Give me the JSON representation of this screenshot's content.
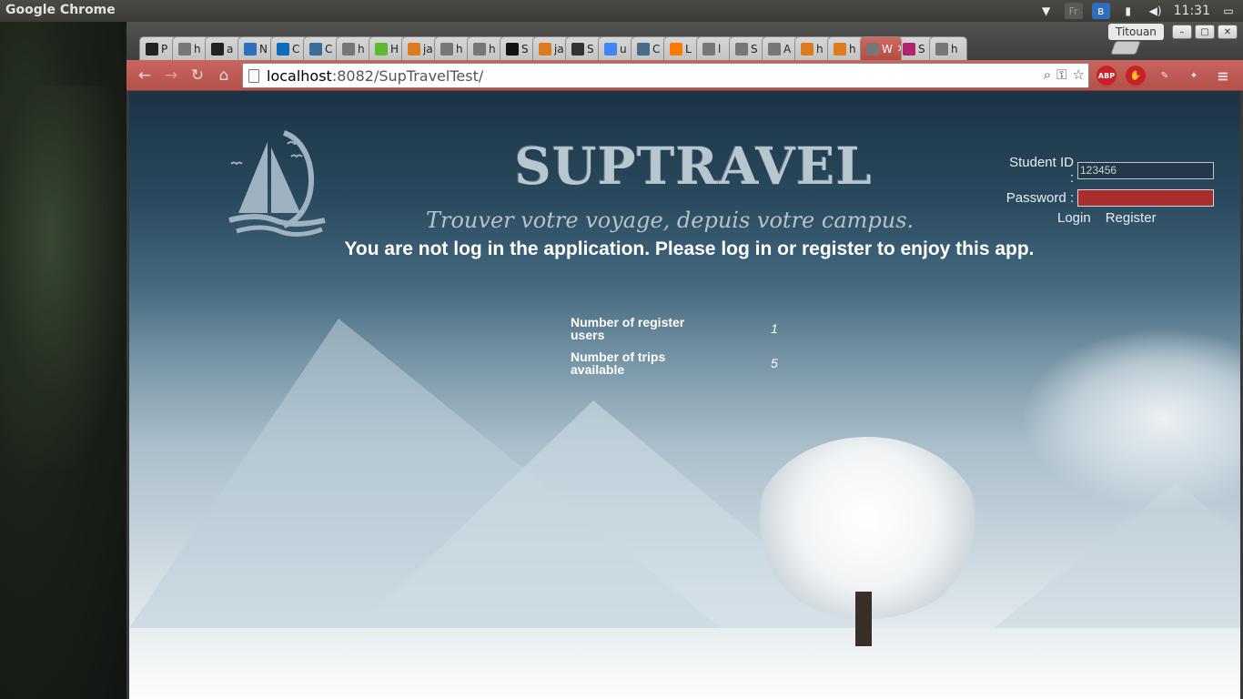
{
  "os": {
    "app_title": "Google Chrome",
    "tray": {
      "keyboard_layout": "Fr",
      "clock": "11:31"
    }
  },
  "browser": {
    "profile_name": "Titouan",
    "tabs": [
      {
        "letter": "P",
        "icon": "github-icon",
        "color": "#222222"
      },
      {
        "letter": "h",
        "icon": "page-icon",
        "color": "#777777"
      },
      {
        "letter": "a",
        "icon": "github-icon",
        "color": "#222222"
      },
      {
        "letter": "N",
        "icon": "mail-icon",
        "color": "#2f6ebd"
      },
      {
        "letter": "C",
        "icon": "outlook-icon",
        "color": "#0f6cbd"
      },
      {
        "letter": "C",
        "icon": "globe-icon",
        "color": "#3a6c9a"
      },
      {
        "letter": "h",
        "icon": "page-icon",
        "color": "#777777"
      },
      {
        "letter": "H",
        "icon": "badge-icon",
        "color": "#5fb830"
      },
      {
        "letter": "ja",
        "icon": "java-icon",
        "color": "#e07a1f"
      },
      {
        "letter": "h",
        "icon": "page-icon",
        "color": "#777777"
      },
      {
        "letter": "h",
        "icon": "page-icon",
        "color": "#777777"
      },
      {
        "letter": "S",
        "icon": "n-icon",
        "color": "#111111"
      },
      {
        "letter": "ja",
        "icon": "java-icon",
        "color": "#e07a1f"
      },
      {
        "letter": "S",
        "icon": "sql-icon",
        "color": "#333333"
      },
      {
        "letter": "u",
        "icon": "google-icon",
        "color": "#4285f4"
      },
      {
        "letter": "C",
        "icon": "globe-icon",
        "color": "#4a6a8a"
      },
      {
        "letter": "L",
        "icon": "orange-icon",
        "color": "#ff7900"
      },
      {
        "letter": "l",
        "icon": "page-icon",
        "color": "#777777"
      },
      {
        "letter": "S",
        "icon": "page-icon",
        "color": "#777777"
      },
      {
        "letter": "A",
        "icon": "page-icon",
        "color": "#777777"
      },
      {
        "letter": "h",
        "icon": "java-icon",
        "color": "#e07a1f"
      },
      {
        "letter": "h",
        "icon": "java-icon",
        "color": "#e07a1f"
      },
      {
        "letter": "W",
        "icon": "page-icon",
        "color": "#777777",
        "active": true
      },
      {
        "letter": "S",
        "icon": "sncf-icon",
        "color": "#b3226c"
      },
      {
        "letter": "h",
        "icon": "page-icon",
        "color": "#777777"
      }
    ],
    "url_host": "localhost",
    "url_rest": ":8082/SupTravelTest/",
    "toolbar_color": "#b85650",
    "extensions": {
      "abp_label": "ABP"
    }
  },
  "page": {
    "site_title": "SUPTRAVEL",
    "tagline": "Trouver votre voyage, depuis votre campus.",
    "notice": "You are not log in the application. Please log in or register to enjoy this app.",
    "login": {
      "student_id_label": "Student ID :",
      "student_id_value": "123456",
      "password_label": "Password :",
      "login_link": "Login",
      "register_link": "Register"
    },
    "stats": [
      {
        "label": "Number of register users",
        "value": "1"
      },
      {
        "label": "Number of trips available",
        "value": "5"
      }
    ]
  }
}
